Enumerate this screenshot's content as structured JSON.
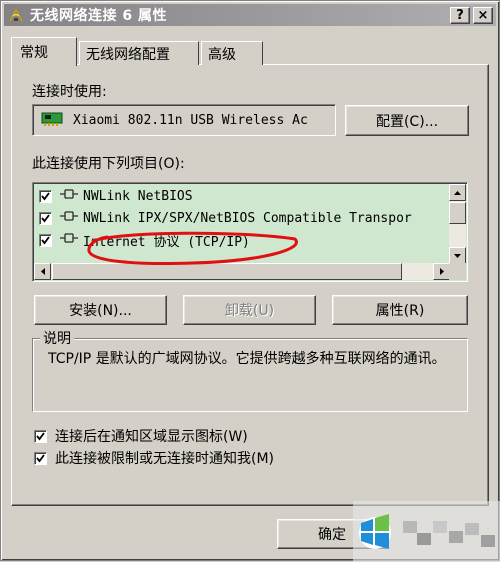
{
  "window": {
    "title": "无线网络连接 6 属性",
    "help_label": "?",
    "close_label": "×"
  },
  "tabs": [
    {
      "label": "常规",
      "active": true
    },
    {
      "label": "无线网络配置",
      "active": false
    },
    {
      "label": "高级",
      "active": false
    }
  ],
  "connect_using": {
    "label": "连接时使用:",
    "adapter": "Xiaomi 802.11n USB Wireless Ac",
    "configure_label": "配置(C)..."
  },
  "items": {
    "label": "此连接使用下列项目(O):",
    "list": [
      {
        "name": "NWLink NetBIOS",
        "checked": true
      },
      {
        "name": "NWLink IPX/SPX/NetBIOS Compatible Transpor",
        "checked": true
      },
      {
        "name": "Internet 协议 (TCP/IP)",
        "checked": true
      }
    ]
  },
  "buttons": {
    "install": "安装(N)...",
    "uninstall": "卸载(U)",
    "properties": "属性(R)"
  },
  "description": {
    "title": "说明",
    "text": "TCP/IP 是默认的广域网协议。它提供跨越多种互联网络的通讯。"
  },
  "options": [
    {
      "label": "连接后在通知区域显示图标(W)",
      "checked": true
    },
    {
      "label": "此连接被限制或无连接时通知我(M)",
      "checked": true
    }
  ],
  "footer": {
    "ok_label": "确定"
  },
  "colors": {
    "annotation": "#e01010",
    "list_background": "#cfe7cf"
  }
}
